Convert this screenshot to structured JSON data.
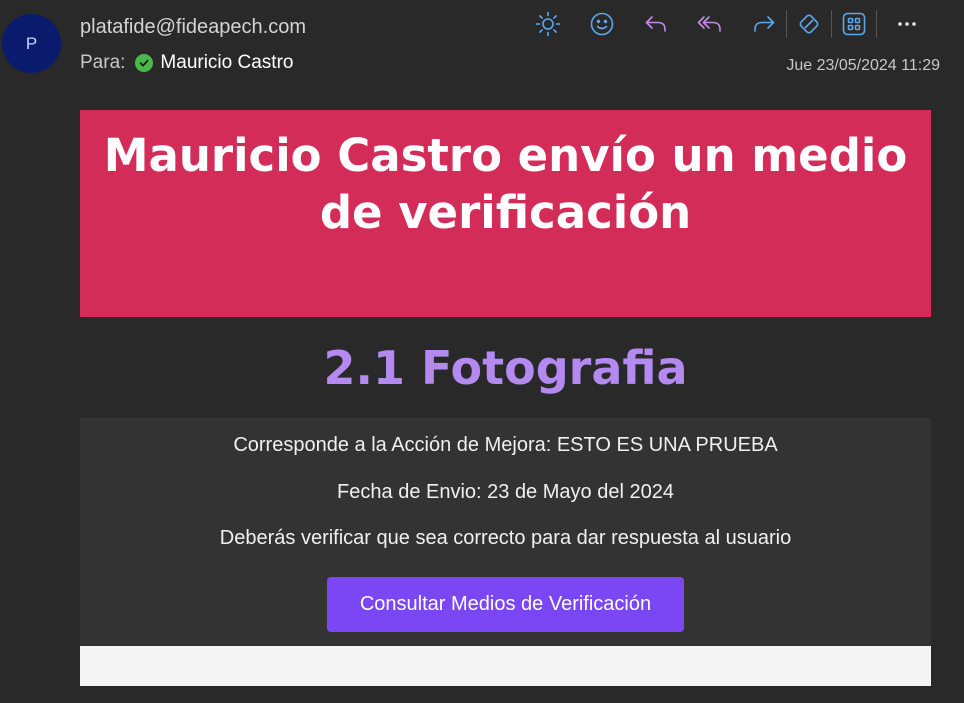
{
  "header": {
    "avatar_initial": "P",
    "sender": "platafide@fideapech.com",
    "to_label": "Para:",
    "to_name": "Mauricio Castro",
    "date": "Jue 23/05/2024 11:29"
  },
  "toolbar": {
    "icons": [
      "sun-icon",
      "emoji-icon",
      "reply-icon",
      "reply-all-icon",
      "forward-icon",
      "sticker-icon",
      "apps-icon",
      "more-icon"
    ],
    "more_label": "···"
  },
  "message": {
    "banner_title": "Mauricio Castro envío un medio de verificación",
    "subtitle": "2.1 Fotografia",
    "action_line": "Corresponde a la Acción de Mejora: ESTO ES UNA PRUEBA",
    "date_line": "Fecha de Envio: 23 de Mayo del 2024",
    "instruction_line": "Deberás verificar que sea correcto para dar respuesta al usuario",
    "cta_label": "Consultar Medios de Verificación"
  },
  "colors": {
    "banner": "#d42c58",
    "subtitle": "#b48af0",
    "cta": "#7b47f5",
    "toolbar_icons": "#5aa9f0",
    "reply_icons": "#c48ae6"
  }
}
